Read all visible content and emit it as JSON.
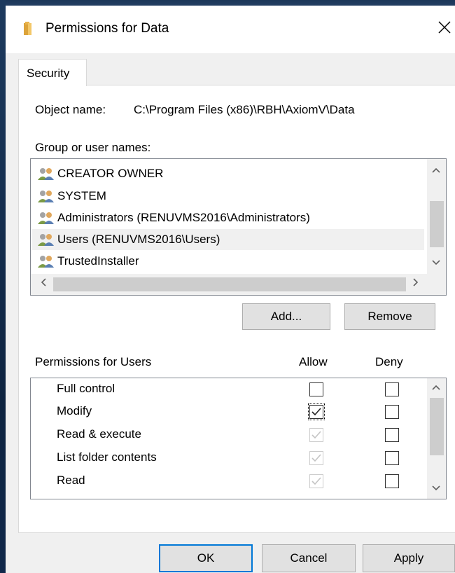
{
  "window": {
    "title": "Permissions for Data",
    "close_label": "✕",
    "folder_icon_color": "#e8b24b"
  },
  "tabs": [
    {
      "label": "Security",
      "selected": true
    }
  ],
  "object_name": {
    "label": "Object name:",
    "value": "C:\\Program Files (x86)\\RBH\\AxiomV\\Data"
  },
  "groups": {
    "label": "Group or user names:",
    "items": [
      {
        "label": "CREATOR OWNER",
        "selected": false
      },
      {
        "label": "SYSTEM",
        "selected": false
      },
      {
        "label": "Administrators (RENUVMS2016\\Administrators)",
        "selected": false
      },
      {
        "label": "Users (RENUVMS2016\\Users)",
        "selected": true
      },
      {
        "label": "TrustedInstaller",
        "selected": false
      }
    ],
    "add_label": "Add...",
    "remove_label": "Remove"
  },
  "permissions": {
    "header": "Permissions for Users",
    "allow_header": "Allow",
    "deny_header": "Deny",
    "rows": [
      {
        "name": "Full control",
        "allow": "unchecked",
        "deny": "unchecked"
      },
      {
        "name": "Modify",
        "allow": "checked-focused",
        "deny": "unchecked"
      },
      {
        "name": "Read & execute",
        "allow": "checked-disabled",
        "deny": "unchecked"
      },
      {
        "name": "List folder contents",
        "allow": "checked-disabled",
        "deny": "unchecked"
      },
      {
        "name": "Read",
        "allow": "checked-disabled",
        "deny": "unchecked"
      }
    ]
  },
  "footer": {
    "ok_label": "OK",
    "cancel_label": "Cancel",
    "apply_label": "Apply"
  },
  "colors": {
    "accent": "#0078d7",
    "selected_row": "#f0f0f0",
    "disabled_check": "#c4c4c4"
  }
}
